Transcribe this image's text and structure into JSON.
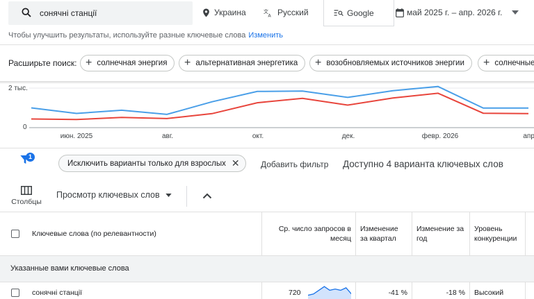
{
  "search": {
    "query": "сонячні станції"
  },
  "filters": {
    "location": "Украина",
    "language": "Русский",
    "engine": "Google",
    "date_range": "май 2025 г. – апр. 2026 г."
  },
  "hint": {
    "text": "Чтобы улучшить результаты, используйте разные ключевые слова",
    "link": "Изменить"
  },
  "expand": {
    "label": "Расширьте поиск:",
    "chips": [
      "солнечная энергия",
      "альтернативная энергетика",
      "возобновляемых источников энергии",
      "солнечные"
    ]
  },
  "chart_data": {
    "type": "line",
    "x": [
      "май 2025",
      "июн. 2025",
      "июл. 2025",
      "авг. 2025",
      "сент. 2025",
      "окт. 2025",
      "нояб. 2025",
      "дек. 2025",
      "янв. 2026",
      "февр. 2026",
      "мар. 2026",
      "апр. 2026"
    ],
    "series": [
      {
        "color": "#4a9fe8",
        "values": [
          1000,
          720,
          880,
          670,
          1310,
          1830,
          1850,
          1530,
          1870,
          2080,
          990,
          990
        ]
      },
      {
        "color": "#e8453c",
        "values": [
          440,
          410,
          520,
          460,
          710,
          1260,
          1480,
          1140,
          1500,
          1740,
          730,
          710
        ]
      }
    ],
    "ylim": [
      0,
      2000
    ],
    "yticks": [
      "0",
      "2 тыс."
    ],
    "xticks": [
      "июн. 2025",
      "авг.",
      "окт.",
      "дек.",
      "февр. 2026",
      "апр."
    ],
    "grid": true
  },
  "filter_bar": {
    "badge": "1",
    "chip": "Исключить варианты только для взрослых",
    "add_filter": "Добавить фильтр",
    "available": "Доступно 4 варианта ключевых слов"
  },
  "toolbar": {
    "columns": "Столбцы",
    "view": "Просмотр ключевых слов"
  },
  "table": {
    "headers": {
      "keyword": "Ключевые слова (по релевантности)",
      "searches": "Ср. число запросов в месяц",
      "quarter": "Изменение за квартал",
      "year": "Изменение за год",
      "competition": "Уровень конкуренции"
    },
    "group": "Указанные вами ключевые слова",
    "rows": [
      {
        "keyword": "сонячні станції",
        "searches": "720",
        "quarter": "-41 %",
        "year": "-18 %",
        "competition": "Высокий",
        "trend": [
          0.3,
          0.4,
          0.7,
          1.0,
          0.7,
          0.8,
          0.7,
          0.9,
          0.4
        ]
      }
    ]
  }
}
